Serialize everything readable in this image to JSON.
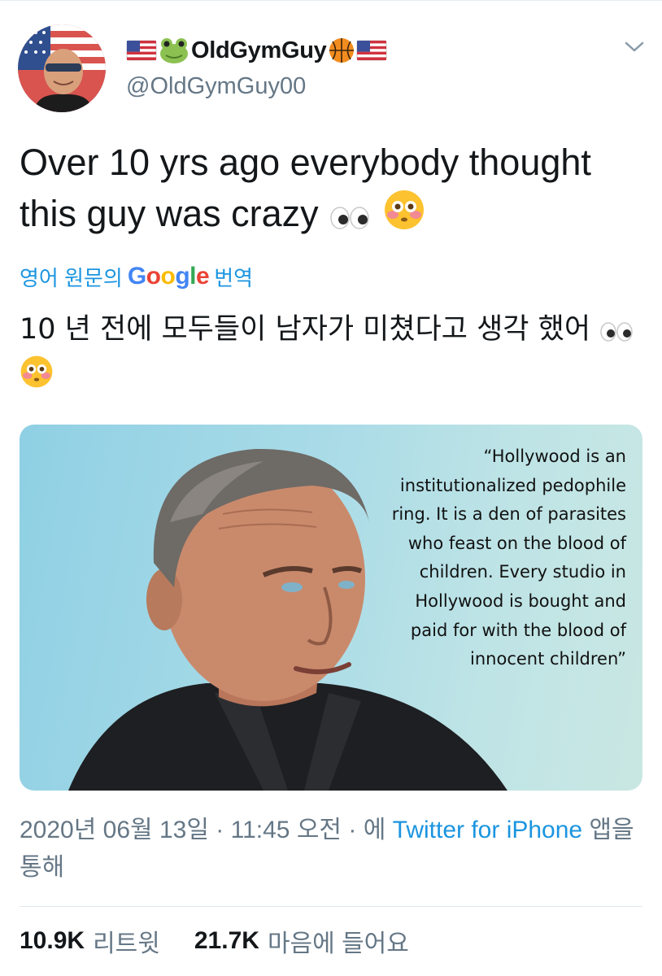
{
  "user": {
    "display_name": "OldGymGuy",
    "handle": "@OldGymGuy00",
    "name_icons": [
      "us-flag-icon",
      "frog-icon",
      "basketball-icon",
      "us-flag-icon"
    ]
  },
  "tweet": {
    "text": "Over 10 yrs ago everybody thought this guy was crazy",
    "text_emojis": [
      "eyes-icon",
      "flushed-face-icon"
    ],
    "translate_prefix": "영어 원문의",
    "translate_brand": "Google",
    "translate_suffix": "번역",
    "translated_text": "10 년 전에 모두들이 남자가 미쳤다고 생각 했어",
    "image_quote": "“Hollywood is an institutionalized pedophile ring. It is a den of parasites who feast on the blood of children. Every studio in Hollywood is bought and paid for with the blood of innocent children”"
  },
  "meta": {
    "date": "2020년 06월 13일",
    "time": "11:45 오전",
    "via_prefix": "에",
    "source": "Twitter for iPhone",
    "via_suffix": "앱을 통해",
    "separator": "·"
  },
  "stats": {
    "retweets": "10.9K",
    "retweets_label": "리트윗",
    "likes": "21.7K",
    "likes_label": "마음에 들어요"
  },
  "colors": {
    "link": "#1b95e0",
    "secondary_text": "#657786",
    "primary_text": "#14171a"
  }
}
